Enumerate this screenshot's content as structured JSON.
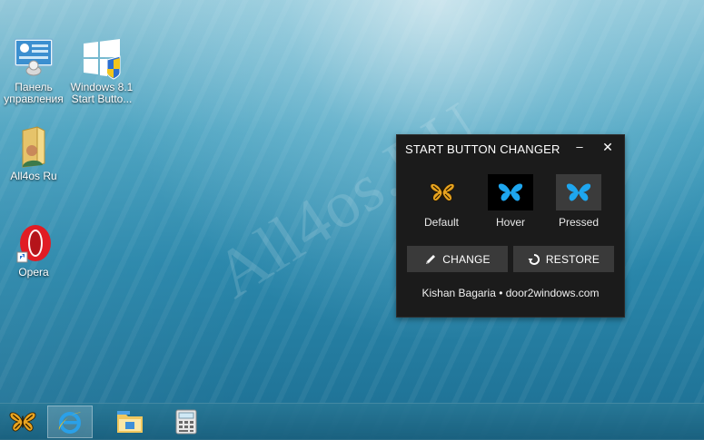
{
  "desktop": {
    "watermark": "All4os.RU",
    "icons": [
      {
        "label_line1": "Панель",
        "label_line2": "управления"
      },
      {
        "label_line1": "Windows 8.1",
        "label_line2": "Start Butto..."
      },
      {
        "label_line1": "All4os Ru",
        "label_line2": ""
      },
      {
        "label_line1": "Opera",
        "label_line2": ""
      }
    ]
  },
  "dialog": {
    "title": "START BUTTON CHANGER",
    "minimize_glyph": "–",
    "close_glyph": "✕",
    "previews": [
      {
        "label": "Default"
      },
      {
        "label": "Hover"
      },
      {
        "label": "Pressed"
      }
    ],
    "change_label": "CHANGE",
    "restore_label": "RESTORE",
    "credit": "Kishan Bagaria • door2windows.com"
  },
  "colors": {
    "butterfly_blue": "#1ea6ef",
    "butterfly_gold": "#e8a420",
    "dialog_bg": "#1b1b1b",
    "button_bg": "#3a3a3a"
  },
  "taskbar": {
    "items": [
      "start-butterfly-icon",
      "internet-explorer-icon",
      "file-explorer-icon",
      "calculator-icon"
    ]
  }
}
